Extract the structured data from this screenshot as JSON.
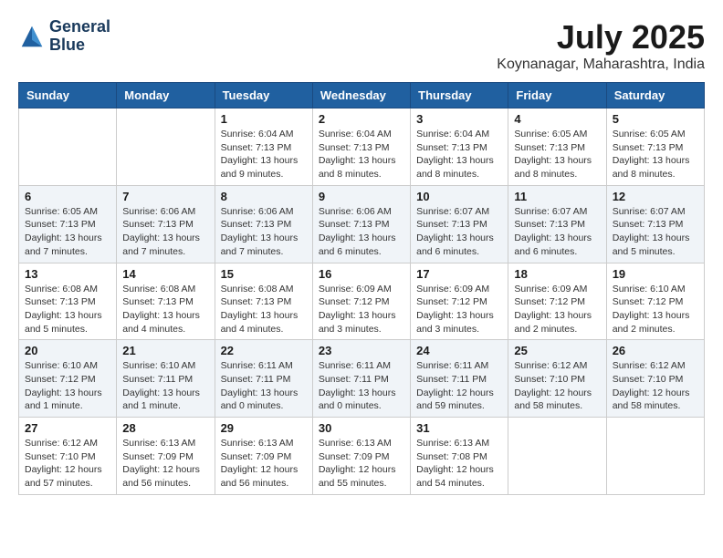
{
  "header": {
    "logo_line1": "General",
    "logo_line2": "Blue",
    "month_year": "July 2025",
    "location": "Koynanagar, Maharashtra, India"
  },
  "days_of_week": [
    "Sunday",
    "Monday",
    "Tuesday",
    "Wednesday",
    "Thursday",
    "Friday",
    "Saturday"
  ],
  "weeks": [
    [
      {
        "day": "",
        "info": ""
      },
      {
        "day": "",
        "info": ""
      },
      {
        "day": "1",
        "info": "Sunrise: 6:04 AM\nSunset: 7:13 PM\nDaylight: 13 hours\nand 9 minutes."
      },
      {
        "day": "2",
        "info": "Sunrise: 6:04 AM\nSunset: 7:13 PM\nDaylight: 13 hours\nand 8 minutes."
      },
      {
        "day": "3",
        "info": "Sunrise: 6:04 AM\nSunset: 7:13 PM\nDaylight: 13 hours\nand 8 minutes."
      },
      {
        "day": "4",
        "info": "Sunrise: 6:05 AM\nSunset: 7:13 PM\nDaylight: 13 hours\nand 8 minutes."
      },
      {
        "day": "5",
        "info": "Sunrise: 6:05 AM\nSunset: 7:13 PM\nDaylight: 13 hours\nand 8 minutes."
      }
    ],
    [
      {
        "day": "6",
        "info": "Sunrise: 6:05 AM\nSunset: 7:13 PM\nDaylight: 13 hours\nand 7 minutes."
      },
      {
        "day": "7",
        "info": "Sunrise: 6:06 AM\nSunset: 7:13 PM\nDaylight: 13 hours\nand 7 minutes."
      },
      {
        "day": "8",
        "info": "Sunrise: 6:06 AM\nSunset: 7:13 PM\nDaylight: 13 hours\nand 7 minutes."
      },
      {
        "day": "9",
        "info": "Sunrise: 6:06 AM\nSunset: 7:13 PM\nDaylight: 13 hours\nand 6 minutes."
      },
      {
        "day": "10",
        "info": "Sunrise: 6:07 AM\nSunset: 7:13 PM\nDaylight: 13 hours\nand 6 minutes."
      },
      {
        "day": "11",
        "info": "Sunrise: 6:07 AM\nSunset: 7:13 PM\nDaylight: 13 hours\nand 6 minutes."
      },
      {
        "day": "12",
        "info": "Sunrise: 6:07 AM\nSunset: 7:13 PM\nDaylight: 13 hours\nand 5 minutes."
      }
    ],
    [
      {
        "day": "13",
        "info": "Sunrise: 6:08 AM\nSunset: 7:13 PM\nDaylight: 13 hours\nand 5 minutes."
      },
      {
        "day": "14",
        "info": "Sunrise: 6:08 AM\nSunset: 7:13 PM\nDaylight: 13 hours\nand 4 minutes."
      },
      {
        "day": "15",
        "info": "Sunrise: 6:08 AM\nSunset: 7:13 PM\nDaylight: 13 hours\nand 4 minutes."
      },
      {
        "day": "16",
        "info": "Sunrise: 6:09 AM\nSunset: 7:12 PM\nDaylight: 13 hours\nand 3 minutes."
      },
      {
        "day": "17",
        "info": "Sunrise: 6:09 AM\nSunset: 7:12 PM\nDaylight: 13 hours\nand 3 minutes."
      },
      {
        "day": "18",
        "info": "Sunrise: 6:09 AM\nSunset: 7:12 PM\nDaylight: 13 hours\nand 2 minutes."
      },
      {
        "day": "19",
        "info": "Sunrise: 6:10 AM\nSunset: 7:12 PM\nDaylight: 13 hours\nand 2 minutes."
      }
    ],
    [
      {
        "day": "20",
        "info": "Sunrise: 6:10 AM\nSunset: 7:12 PM\nDaylight: 13 hours\nand 1 minute."
      },
      {
        "day": "21",
        "info": "Sunrise: 6:10 AM\nSunset: 7:11 PM\nDaylight: 13 hours\nand 1 minute."
      },
      {
        "day": "22",
        "info": "Sunrise: 6:11 AM\nSunset: 7:11 PM\nDaylight: 13 hours\nand 0 minutes."
      },
      {
        "day": "23",
        "info": "Sunrise: 6:11 AM\nSunset: 7:11 PM\nDaylight: 13 hours\nand 0 minutes."
      },
      {
        "day": "24",
        "info": "Sunrise: 6:11 AM\nSunset: 7:11 PM\nDaylight: 12 hours\nand 59 minutes."
      },
      {
        "day": "25",
        "info": "Sunrise: 6:12 AM\nSunset: 7:10 PM\nDaylight: 12 hours\nand 58 minutes."
      },
      {
        "day": "26",
        "info": "Sunrise: 6:12 AM\nSunset: 7:10 PM\nDaylight: 12 hours\nand 58 minutes."
      }
    ],
    [
      {
        "day": "27",
        "info": "Sunrise: 6:12 AM\nSunset: 7:10 PM\nDaylight: 12 hours\nand 57 minutes."
      },
      {
        "day": "28",
        "info": "Sunrise: 6:13 AM\nSunset: 7:09 PM\nDaylight: 12 hours\nand 56 minutes."
      },
      {
        "day": "29",
        "info": "Sunrise: 6:13 AM\nSunset: 7:09 PM\nDaylight: 12 hours\nand 56 minutes."
      },
      {
        "day": "30",
        "info": "Sunrise: 6:13 AM\nSunset: 7:09 PM\nDaylight: 12 hours\nand 55 minutes."
      },
      {
        "day": "31",
        "info": "Sunrise: 6:13 AM\nSunset: 7:08 PM\nDaylight: 12 hours\nand 54 minutes."
      },
      {
        "day": "",
        "info": ""
      },
      {
        "day": "",
        "info": ""
      }
    ]
  ]
}
